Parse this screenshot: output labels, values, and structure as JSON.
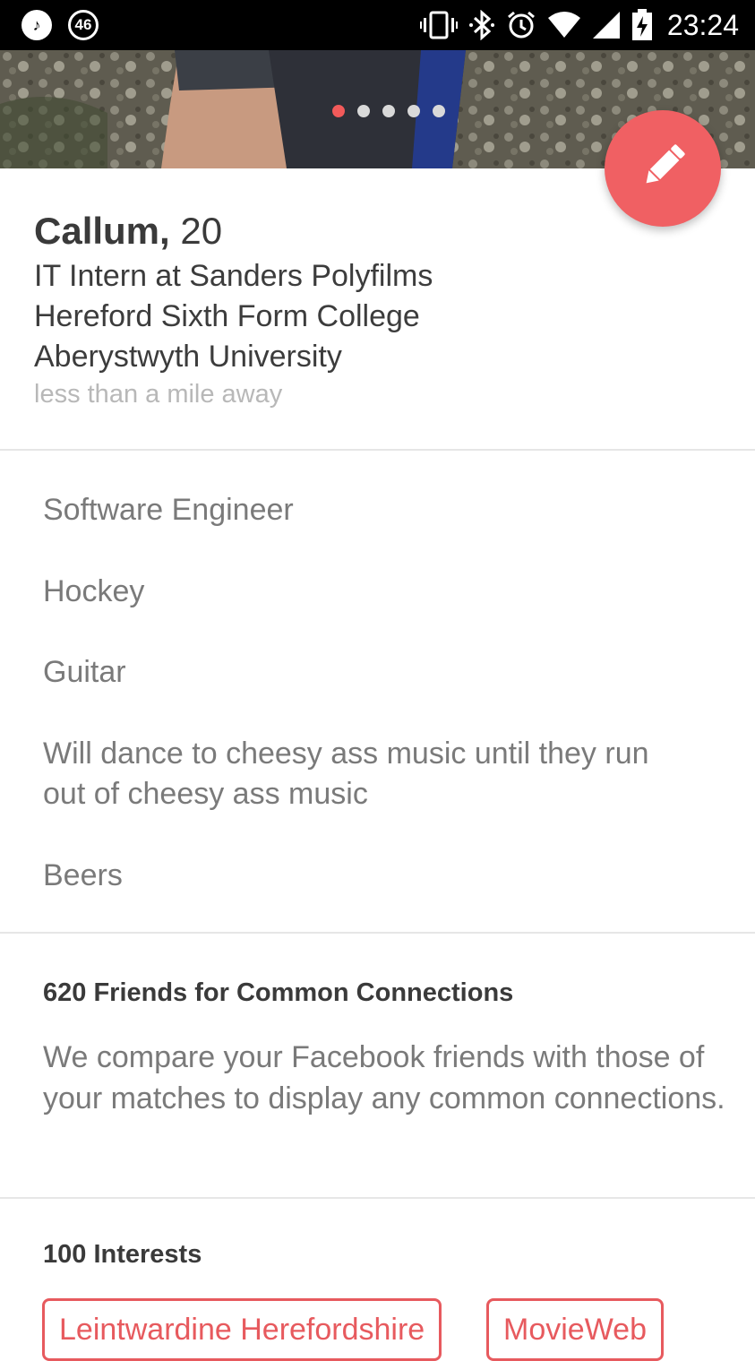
{
  "status_bar": {
    "notif_badge": "46",
    "time": "23:24"
  },
  "photo": {
    "dots": 5,
    "active_dot": 0
  },
  "profile": {
    "name": "Callum,",
    "age": "20",
    "job": "IT Intern at Sanders Polyfilms",
    "school_1": "Hereford Sixth Form College",
    "school_2": "Aberystwyth University",
    "distance": "less than a mile away"
  },
  "bio": {
    "line_1": "Software Engineer",
    "line_2": "Hockey",
    "line_3": "Guitar",
    "line_4a": "Will dance to cheesy ass music until they run",
    "line_4b": "out of cheesy ass music",
    "line_5": "Beers"
  },
  "connections": {
    "title": "620 Friends for Common Connections",
    "body": "We compare your Facebook friends with those of your matches to display any common connections."
  },
  "interests": {
    "title": "100 Interests",
    "items": [
      "Leintwardine Herefordshire",
      "MovieWeb"
    ]
  },
  "colors": {
    "accent": "#f06063",
    "chip": "#e75a5e"
  },
  "icons": {
    "music": "music-note-icon",
    "vibrate": "vibrate-icon",
    "bluetooth": "bluetooth-icon",
    "alarm": "alarm-icon",
    "wifi": "wifi-icon",
    "signal": "signal-icon",
    "battery": "battery-charging-icon",
    "edit": "pencil-icon"
  }
}
